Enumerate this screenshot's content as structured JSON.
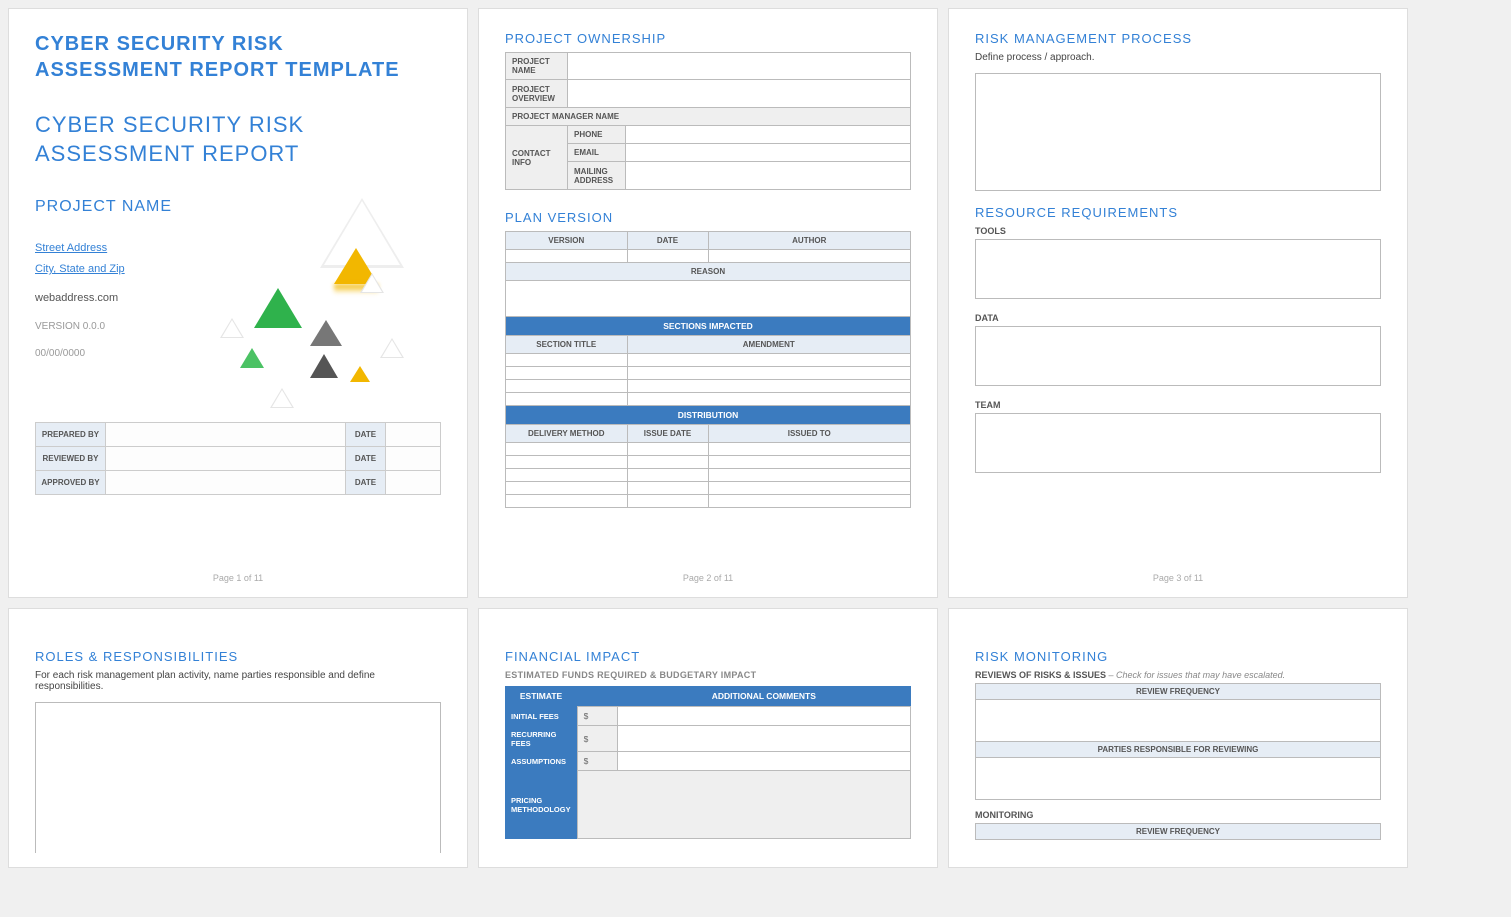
{
  "page1": {
    "titleBold1": "CYBER SECURITY RISK",
    "titleBold2": "ASSESSMENT REPORT TEMPLATE",
    "titleLight1": "CYBER SECURITY RISK",
    "titleLight2": "ASSESSMENT REPORT",
    "projectName": "PROJECT NAME",
    "street": "Street Address",
    "cityStateZip": "City, State and Zip",
    "web": "webaddress.com",
    "version": "VERSION 0.0.0",
    "date": "00/00/0000",
    "meta": {
      "preparedBy": "PREPARED BY",
      "reviewedBy": "REVIEWED BY",
      "approvedBy": "APPROVED BY",
      "dateLabel": "DATE"
    },
    "footer": "Page 1 of 11"
  },
  "page2": {
    "ownershipTitle": "PROJECT OWNERSHIP",
    "projectName": "PROJECT NAME",
    "projectOverview": "PROJECT OVERVIEW",
    "pmName": "PROJECT MANAGER NAME",
    "contactInfo": "CONTACT INFO",
    "phone": "PHONE",
    "email": "EMAIL",
    "mailing": "MAILING ADDRESS",
    "planVersionTitle": "PLAN VERSION",
    "version": "VERSION",
    "date": "DATE",
    "author": "AUTHOR",
    "reason": "REASON",
    "sectionsImpacted": "SECTIONS IMPACTED",
    "sectionTitle": "SECTION TITLE",
    "amendment": "AMENDMENT",
    "distribution": "DISTRIBUTION",
    "deliveryMethod": "DELIVERY METHOD",
    "issueDate": "ISSUE DATE",
    "issuedTo": "ISSUED TO",
    "footer": "Page 2 of 11"
  },
  "page3": {
    "rmpTitle": "RISK MANAGEMENT PROCESS",
    "rmpDesc": "Define process / approach.",
    "resTitle": "RESOURCE REQUIREMENTS",
    "tools": "TOOLS",
    "data": "DATA",
    "team": "TEAM",
    "footer": "Page 3 of 11"
  },
  "page4": {
    "title": "ROLES & RESPONSIBILITIES",
    "desc": "For each risk management plan activity, name parties responsible and define responsibilities."
  },
  "page5": {
    "title": "FINANCIAL IMPACT",
    "sub": "ESTIMATED FUNDS REQUIRED & BUDGETARY IMPACT",
    "estimate": "ESTIMATE",
    "additional": "ADDITIONAL COMMENTS",
    "initialFees": "INITIAL FEES",
    "recurringFees": "RECURRING FEES",
    "assumptions": "ASSUMPTIONS",
    "pricing": "PRICING METHODOLOGY",
    "dollar": "$"
  },
  "page6": {
    "title": "RISK MONITORING",
    "reviewsTitle": "REVIEWS OF RISKS & ISSUES",
    "reviewsHint": " – Check for issues that may have escalated.",
    "reviewFreq": "REVIEW FREQUENCY",
    "partiesResp": "PARTIES RESPONSIBLE FOR REVIEWING",
    "monitoring": "MONITORING"
  }
}
